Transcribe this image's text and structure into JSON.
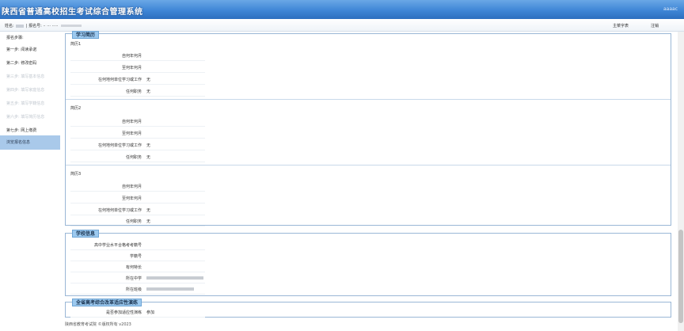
{
  "header": {
    "title": "陕西省普通高校招生考试综合管理系统",
    "right_text": "aaaac"
  },
  "userbar": {
    "name_label": "姓名:",
    "number_label": "| 报名号:",
    "number_value": "·· ··· ·····",
    "user_menu": "主菜字表",
    "logout": "注销"
  },
  "sidebar": {
    "title": "报名步骤:",
    "items": [
      {
        "label": "第一步: 阅读承诺",
        "state": "normal"
      },
      {
        "label": "第二步: 修改密码",
        "state": "normal"
      },
      {
        "label": "第三步: 填写基本信息",
        "state": "disabled"
      },
      {
        "label": "第四步: 填写家庭信息",
        "state": "disabled"
      },
      {
        "label": "第五步: 填写学籍信息",
        "state": "disabled"
      },
      {
        "label": "第六步: 填写简历信息",
        "state": "disabled"
      },
      {
        "label": "第七步: 网上缴费",
        "state": "normal"
      },
      {
        "label": "浏览报名信息",
        "state": "active"
      }
    ]
  },
  "resume": {
    "title": "学习简历",
    "groups": [
      {
        "label": "简历1",
        "rows": [
          {
            "label": "自何年何月",
            "value": ""
          },
          {
            "label": "至何年何月",
            "value": ""
          },
          {
            "label": "在何地何单位学习或工作",
            "value": "无"
          },
          {
            "label": "任何职务",
            "value": "无"
          }
        ]
      },
      {
        "label": "简历2",
        "rows": [
          {
            "label": "自何年何月",
            "value": ""
          },
          {
            "label": "至何年何月",
            "value": ""
          },
          {
            "label": "在何地何单位学习或工作",
            "value": "无"
          },
          {
            "label": "任何职务",
            "value": "无"
          }
        ]
      },
      {
        "label": "简历3",
        "rows": [
          {
            "label": "自何年何月",
            "value": ""
          },
          {
            "label": "至何年何月",
            "value": ""
          },
          {
            "label": "在何地何单位学习或工作",
            "value": "无"
          },
          {
            "label": "任何职务",
            "value": "无"
          }
        ]
      }
    ]
  },
  "school": {
    "title": "学校信息",
    "rows": [
      {
        "label": "高中学业水平合格考考籍号",
        "value": ""
      },
      {
        "label": "学籍号",
        "value": ""
      },
      {
        "label": "有何特长",
        "value": ""
      },
      {
        "label": "所在中学",
        "value": ""
      },
      {
        "label": "所在班级",
        "value": ""
      }
    ]
  },
  "reform": {
    "title": "全省高考综合改革适应性演练",
    "rows": [
      {
        "label": "是否参加适应性演练",
        "value": "参加"
      }
    ]
  },
  "footer": {
    "text": "陕西省教育考试院 ©版权所有 v2023"
  }
}
